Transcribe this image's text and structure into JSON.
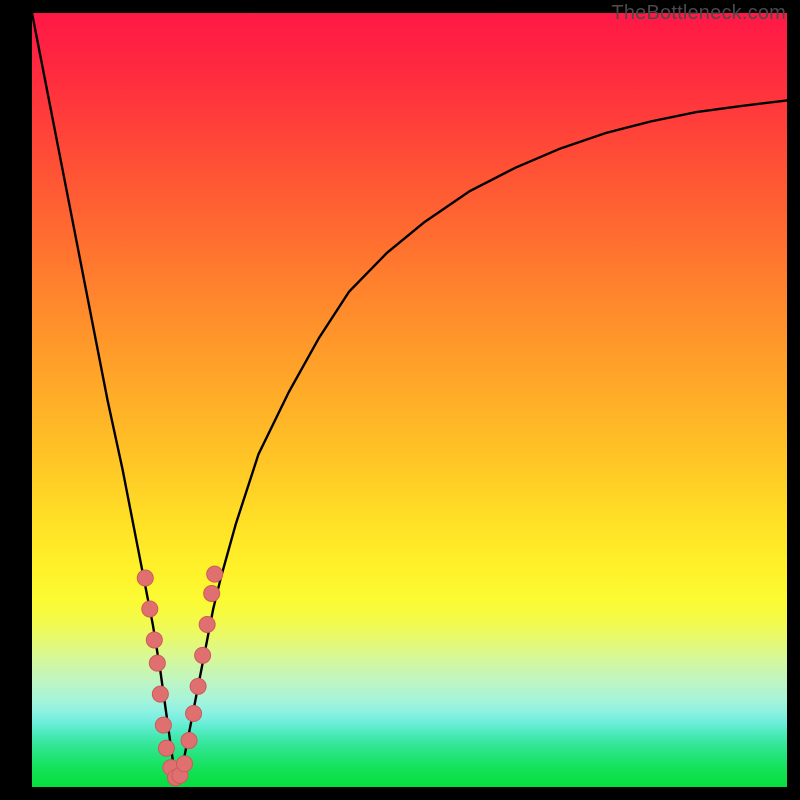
{
  "watermark": "TheBottleneck.com",
  "colors": {
    "curve_stroke": "#000000",
    "marker_fill": "#e07070",
    "marker_stroke": "#cc5a5a",
    "gradient_top": "#ff1846",
    "gradient_mid": "#fff22a",
    "gradient_bottom": "#06df3f",
    "bg": "#000000"
  },
  "chart_data": {
    "type": "line",
    "title": "",
    "xlabel": "",
    "ylabel": "",
    "x_range": [
      0,
      100
    ],
    "y_range": [
      0,
      100
    ],
    "note": "Axes are unlabeled; values are read as relative percentages of the plot area (0 = left/bottom, 100 = right/top). Curve is a V-shaped bottleneck profile with minimum near x≈19, y≈0.",
    "series": [
      {
        "name": "bottleneck-curve",
        "x": [
          0,
          2,
          4,
          6,
          8,
          10,
          12,
          14,
          15,
          16,
          17,
          18,
          19,
          20,
          21,
          22,
          23,
          24,
          25,
          27,
          30,
          34,
          38,
          42,
          47,
          52,
          58,
          64,
          70,
          76,
          82,
          88,
          94,
          100
        ],
        "y": [
          100,
          90,
          80,
          70,
          60,
          50,
          41,
          31,
          26,
          21,
          15,
          8,
          1,
          3,
          8,
          13,
          18,
          23,
          27,
          34,
          43,
          51,
          58,
          64,
          69,
          73,
          77,
          80,
          82.5,
          84.5,
          86,
          87.2,
          88,
          88.7
        ]
      }
    ],
    "markers": {
      "name": "highlighted-near-minimum",
      "note": "Pink dot markers clustered on both sides of the curve minimum.",
      "points": [
        {
          "x": 15.0,
          "y": 27
        },
        {
          "x": 15.6,
          "y": 23
        },
        {
          "x": 16.2,
          "y": 19
        },
        {
          "x": 16.6,
          "y": 16
        },
        {
          "x": 17.0,
          "y": 12
        },
        {
          "x": 17.4,
          "y": 8
        },
        {
          "x": 17.8,
          "y": 5
        },
        {
          "x": 18.4,
          "y": 2.5
        },
        {
          "x": 19.0,
          "y": 1.2
        },
        {
          "x": 19.6,
          "y": 1.5
        },
        {
          "x": 20.2,
          "y": 3
        },
        {
          "x": 20.8,
          "y": 6
        },
        {
          "x": 21.4,
          "y": 9.5
        },
        {
          "x": 22.0,
          "y": 13
        },
        {
          "x": 22.6,
          "y": 17
        },
        {
          "x": 23.2,
          "y": 21
        },
        {
          "x": 23.8,
          "y": 25
        },
        {
          "x": 24.2,
          "y": 27.5
        }
      ]
    }
  }
}
